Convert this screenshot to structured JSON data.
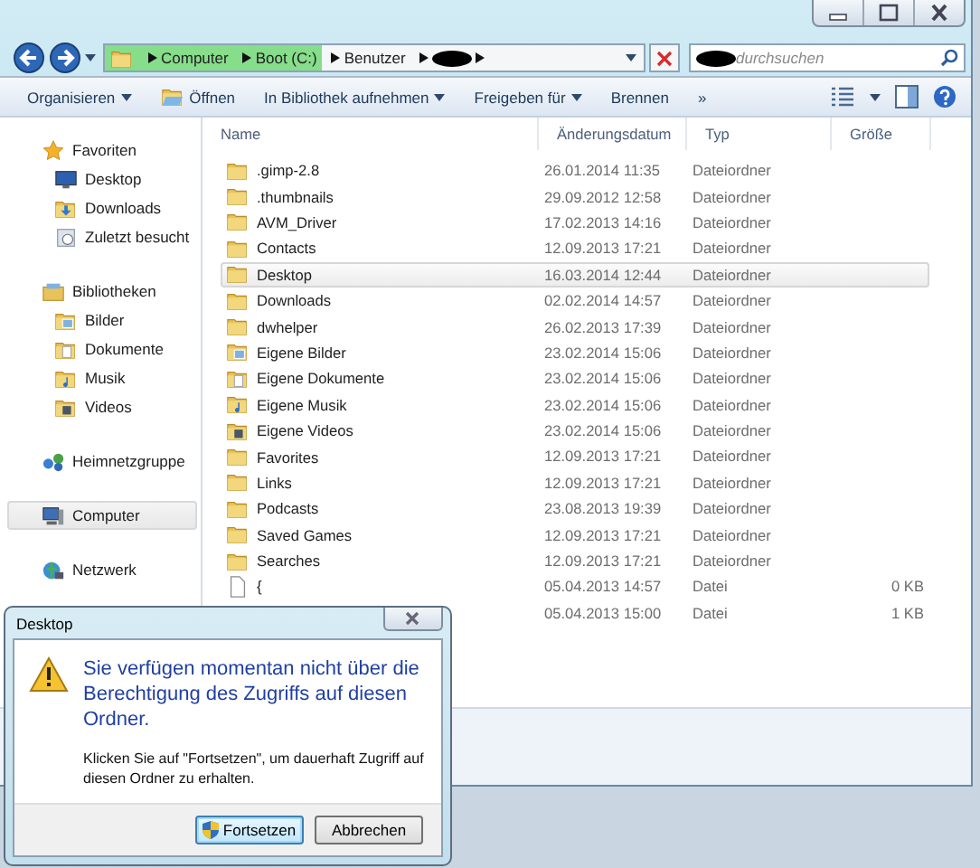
{
  "address_bar": {
    "crumbs": [
      {
        "label": "Computer",
        "highlighted": true
      },
      {
        "label": "Boot (C:)",
        "highlighted": true
      },
      {
        "label": "Benutzer",
        "highlighted": false
      }
    ]
  },
  "search": {
    "placeholder": "durchsuchen"
  },
  "toolbar": [
    {
      "label": "Organisieren",
      "kind": "menu"
    },
    {
      "label": "Öffnen",
      "kind": "open"
    },
    {
      "label": "In Bibliothek aufnehmen",
      "kind": "menu"
    },
    {
      "label": "Freigeben für",
      "kind": "menu"
    },
    {
      "label": "Brennen",
      "kind": "plain"
    },
    {
      "label": "»",
      "kind": "plain"
    }
  ],
  "sidebar": {
    "items": [
      {
        "label": "Favoriten",
        "kind": "star",
        "selected": false,
        "children": [
          {
            "label": "Desktop",
            "kind": "desktop",
            "selected": false
          },
          {
            "label": "Downloads",
            "kind": "downloads",
            "selected": false
          },
          {
            "label": "Zuletzt besucht",
            "kind": "recent",
            "selected": false
          }
        ]
      },
      {
        "label": "Bibliotheken",
        "kind": "libraries",
        "selected": false,
        "children": [
          {
            "label": "Bilder",
            "kind": "pictures",
            "selected": false
          },
          {
            "label": "Dokumente",
            "kind": "documents",
            "selected": false
          },
          {
            "label": "Musik",
            "kind": "music",
            "selected": false
          },
          {
            "label": "Videos",
            "kind": "videos",
            "selected": false
          }
        ]
      },
      {
        "label": "Heimnetzgruppe",
        "kind": "homegroup",
        "selected": false
      },
      {
        "label": "Computer",
        "kind": "computer",
        "selected": true
      },
      {
        "label": "Netzwerk",
        "kind": "network",
        "selected": false
      }
    ]
  },
  "table": {
    "columns": [
      "Name",
      "Änderungsdatum",
      "Typ",
      "Größe"
    ],
    "rows": [
      {
        "name": ".gimp-2.8",
        "date": "26.01.2014 11:35",
        "type": "Dateiordner",
        "kind": "folder",
        "selected": false
      },
      {
        "name": ".thumbnails",
        "date": "29.09.2012 12:58",
        "type": "Dateiordner",
        "kind": "folder",
        "selected": false
      },
      {
        "name": "AVM_Driver",
        "date": "17.02.2013 14:16",
        "type": "Dateiordner",
        "kind": "folder",
        "selected": false
      },
      {
        "name": "Contacts",
        "date": "12.09.2013 17:21",
        "type": "Dateiordner",
        "kind": "folder",
        "selected": false
      },
      {
        "name": "Desktop",
        "date": "16.03.2014 12:44",
        "type": "Dateiordner",
        "kind": "folder",
        "selected": true
      },
      {
        "name": "Downloads",
        "date": "02.02.2014 14:57",
        "type": "Dateiordner",
        "kind": "folder",
        "selected": false
      },
      {
        "name": "dwhelper",
        "date": "26.02.2013 17:39",
        "type": "Dateiordner",
        "kind": "folder",
        "selected": false
      },
      {
        "name": "Eigene Bilder",
        "date": "23.02.2014 15:06",
        "type": "Dateiordner",
        "kind": "pictures",
        "selected": false
      },
      {
        "name": "Eigene Dokumente",
        "date": "23.02.2014 15:06",
        "type": "Dateiordner",
        "kind": "documents",
        "selected": false
      },
      {
        "name": "Eigene Musik",
        "date": "23.02.2014 15:06",
        "type": "Dateiordner",
        "kind": "music",
        "selected": false
      },
      {
        "name": "Eigene Videos",
        "date": "23.02.2014 15:06",
        "type": "Dateiordner",
        "kind": "videos",
        "selected": false
      },
      {
        "name": "Favorites",
        "date": "12.09.2013 17:21",
        "type": "Dateiordner",
        "kind": "folder",
        "selected": false
      },
      {
        "name": "Links",
        "date": "12.09.2013 17:21",
        "type": "Dateiordner",
        "kind": "folder",
        "selected": false
      },
      {
        "name": "Podcasts",
        "date": "23.08.2013 19:39",
        "type": "Dateiordner",
        "kind": "folder",
        "selected": false
      },
      {
        "name": "Saved Games",
        "date": "12.09.2013 17:21",
        "type": "Dateiordner",
        "kind": "folder",
        "selected": false
      },
      {
        "name": "Searches",
        "date": "12.09.2013 17:21",
        "type": "Dateiordner",
        "kind": "folder",
        "selected": false
      },
      {
        "name": "{",
        "date": "05.04.2013 14:57",
        "type": "Datei",
        "size": "0 KB",
        "kind": "file",
        "selected": false
      },
      {
        "date": "05.04.2013 15:00",
        "type": "Datei",
        "size": "1 KB",
        "selected": false
      }
    ]
  },
  "dialog": {
    "title": "Desktop",
    "message": "Sie verfügen momentan nicht über die Berechtigung des Zugriffs auf diesen Ordner.",
    "detail": "Klicken Sie auf \"Fortsetzen\", um dauerhaft Zugriff auf diesen Ordner zu erhalten.",
    "buttons": [
      {
        "label": "Fortsetzen",
        "default": true
      },
      {
        "label": "Abbrechen",
        "default": false
      }
    ]
  }
}
